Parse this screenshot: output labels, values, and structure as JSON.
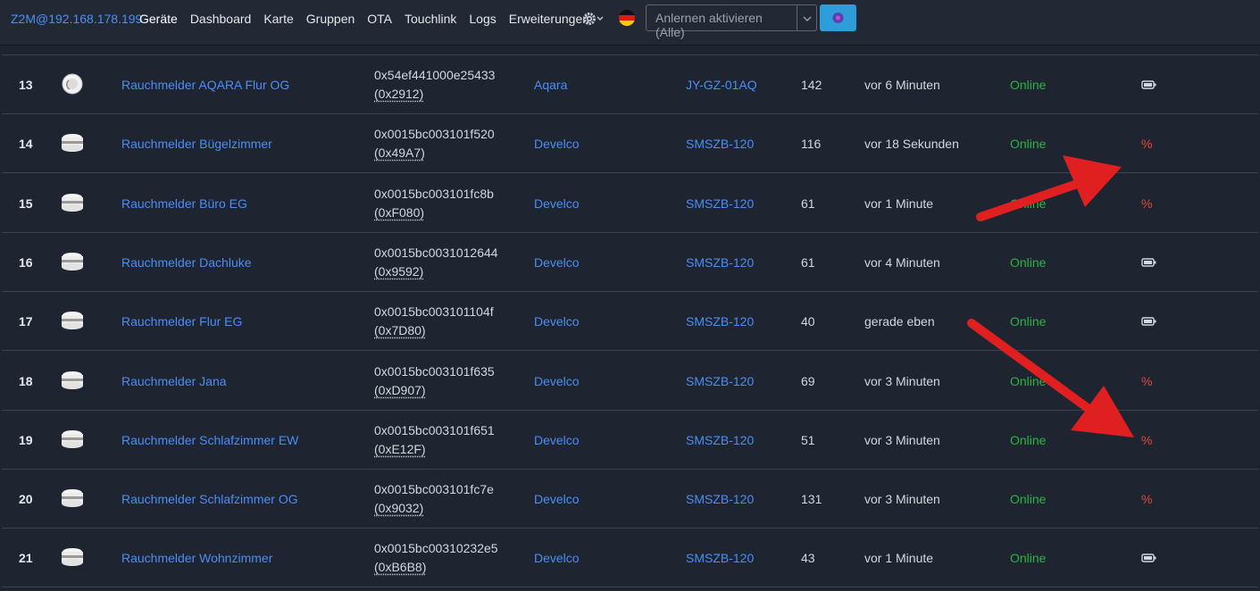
{
  "navbar": {
    "brand": "Z2M@192.168.178.199",
    "items": [
      "Geräte",
      "Dashboard",
      "Karte",
      "Gruppen",
      "OTA",
      "Touchlink",
      "Logs",
      "Erweiterungen"
    ],
    "permit_join_label": "Anlernen aktivieren (Alle)"
  },
  "devices": [
    {
      "num": "13",
      "name": "Rauchmelder AQARA Flur OG",
      "ieee": "0x54ef441000e25433",
      "nwk": "(0x2912)",
      "vendor": "Aqara",
      "model": "JY-GZ-01AQ",
      "lqi": "142",
      "last_seen": "vor 6 Minuten",
      "status": "Online",
      "power": "battery-icon",
      "image": "aqara-smoke-detector"
    },
    {
      "num": "14",
      "name": "Rauchmelder Bügelzimmer",
      "ieee": "0x0015bc003101f520",
      "nwk": "(0x49A7)",
      "vendor": "Develco",
      "model": "SMSZB-120",
      "lqi": "116",
      "last_seen": "vor 18 Sekunden",
      "status": "Online",
      "power": "%",
      "image": "develco-smoke-detector"
    },
    {
      "num": "15",
      "name": "Rauchmelder Büro EG",
      "ieee": "0x0015bc003101fc8b",
      "nwk": "(0xF080)",
      "vendor": "Develco",
      "model": "SMSZB-120",
      "lqi": "61",
      "last_seen": "vor 1 Minute",
      "status": "Online",
      "power": "%",
      "image": "develco-smoke-detector"
    },
    {
      "num": "16",
      "name": "Rauchmelder Dachluke",
      "ieee": "0x0015bc0031012644",
      "nwk": "(0x9592)",
      "vendor": "Develco",
      "model": "SMSZB-120",
      "lqi": "61",
      "last_seen": "vor 4 Minuten",
      "status": "Online",
      "power": "battery-icon",
      "image": "develco-smoke-detector"
    },
    {
      "num": "17",
      "name": "Rauchmelder Flur EG",
      "ieee": "0x0015bc003101104f",
      "nwk": "(0x7D80)",
      "vendor": "Develco",
      "model": "SMSZB-120",
      "lqi": "40",
      "last_seen": "gerade eben",
      "status": "Online",
      "power": "battery-icon",
      "image": "develco-smoke-detector"
    },
    {
      "num": "18",
      "name": "Rauchmelder Jana",
      "ieee": "0x0015bc003101f635",
      "nwk": "(0xD907)",
      "vendor": "Develco",
      "model": "SMSZB-120",
      "lqi": "69",
      "last_seen": "vor 3 Minuten",
      "status": "Online",
      "power": "%",
      "image": "develco-smoke-detector"
    },
    {
      "num": "19",
      "name": "Rauchmelder Schlafzimmer EW",
      "ieee": "0x0015bc003101f651",
      "nwk": "(0xE12F)",
      "vendor": "Develco",
      "model": "SMSZB-120",
      "lqi": "51",
      "last_seen": "vor 3 Minuten",
      "status": "Online",
      "power": "%",
      "image": "develco-smoke-detector"
    },
    {
      "num": "20",
      "name": "Rauchmelder Schlafzimmer OG",
      "ieee": "0x0015bc003101fc7e",
      "nwk": "(0x9032)",
      "vendor": "Develco",
      "model": "SMSZB-120",
      "lqi": "131",
      "last_seen": "vor 3 Minuten",
      "status": "Online",
      "power": "%",
      "image": "develco-smoke-detector"
    },
    {
      "num": "21",
      "name": "Rauchmelder Wohnzimmer",
      "ieee": "0x0015bc00310232e5",
      "nwk": "(0xB6B8)",
      "vendor": "Develco",
      "model": "SMSZB-120",
      "lqi": "43",
      "last_seen": "vor 1 Minute",
      "status": "Online",
      "power": "battery-icon",
      "image": "develco-smoke-detector"
    }
  ],
  "colors": {
    "link": "#4c8df6",
    "online": "#2fb344",
    "warning": "#e04a3c",
    "annotation_arrow": "#e02020",
    "background": "#1e2430"
  }
}
